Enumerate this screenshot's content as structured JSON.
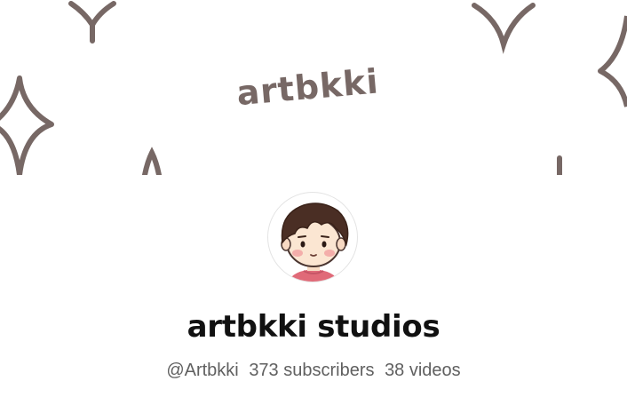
{
  "banner": {
    "text": "artbkki",
    "ink_color": "#776865"
  },
  "avatar": {
    "icon": "avatar-cartoon-boy"
  },
  "channel": {
    "name": "artbkki studios",
    "handle": "@Artbkki",
    "subscribers": "373 subscribers",
    "videos": "38 videos"
  }
}
